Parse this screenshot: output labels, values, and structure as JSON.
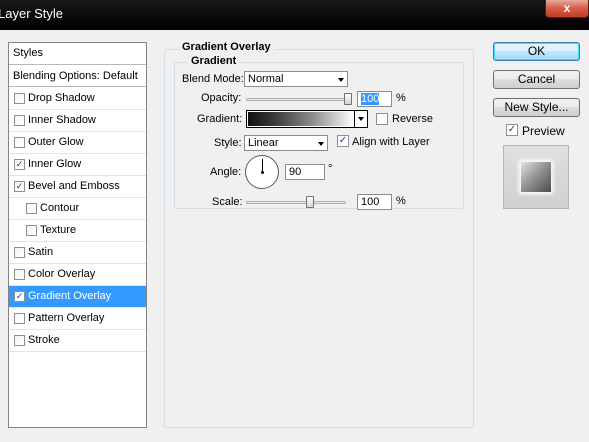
{
  "window": {
    "title": "Layer Style",
    "close_glyph": "x"
  },
  "styles_panel": {
    "header": "Styles",
    "blending_options": "Blending Options: Default",
    "items": [
      {
        "label": "Drop Shadow",
        "checked": false,
        "indent": false,
        "selected": false
      },
      {
        "label": "Inner Shadow",
        "checked": false,
        "indent": false,
        "selected": false
      },
      {
        "label": "Outer Glow",
        "checked": false,
        "indent": false,
        "selected": false
      },
      {
        "label": "Inner Glow",
        "checked": true,
        "indent": false,
        "selected": false
      },
      {
        "label": "Bevel and Emboss",
        "checked": true,
        "indent": false,
        "selected": false
      },
      {
        "label": "Contour",
        "checked": false,
        "indent": true,
        "selected": false
      },
      {
        "label": "Texture",
        "checked": false,
        "indent": true,
        "selected": false
      },
      {
        "label": "Satin",
        "checked": false,
        "indent": false,
        "selected": false
      },
      {
        "label": "Color Overlay",
        "checked": false,
        "indent": false,
        "selected": false
      },
      {
        "label": "Gradient Overlay",
        "checked": true,
        "indent": false,
        "selected": true
      },
      {
        "label": "Pattern Overlay",
        "checked": false,
        "indent": false,
        "selected": false
      },
      {
        "label": "Stroke",
        "checked": false,
        "indent": false,
        "selected": false
      }
    ]
  },
  "gradient_overlay": {
    "section_title": "Gradient Overlay",
    "group_title": "Gradient",
    "blend_mode_label": "Blend Mode:",
    "blend_mode_value": "Normal",
    "opacity_label": "Opacity:",
    "opacity_value": "100",
    "opacity_unit": "%",
    "opacity_level": 1.0,
    "gradient_label": "Gradient:",
    "reverse_label": "Reverse",
    "reverse_checked": false,
    "style_label": "Style:",
    "style_value": "Linear",
    "align_label": "Align with Layer",
    "align_checked": true,
    "angle_label": "Angle:",
    "angle_value": "90",
    "angle_unit": "°",
    "scale_label": "Scale:",
    "scale_value": "100",
    "scale_unit": "%",
    "scale_level": 0.6
  },
  "buttons": {
    "ok": "OK",
    "cancel": "Cancel",
    "new_style": "New Style...",
    "preview_label": "Preview",
    "preview_checked": true
  },
  "check_glyph": "✓"
}
